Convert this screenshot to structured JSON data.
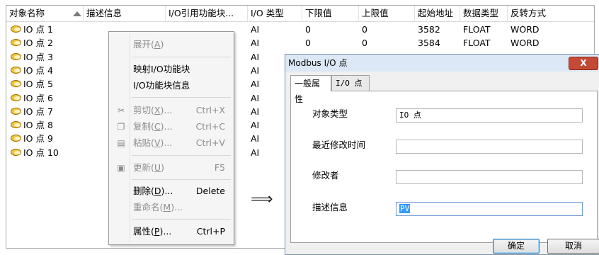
{
  "list": {
    "columns": [
      "对象名称",
      "描述信息",
      "I/O引用功能块...",
      "I/O 类型",
      "下限值",
      "上限值",
      "起始地址",
      "数据类型",
      "反转方式"
    ],
    "rows": [
      {
        "name": "IO 点 1",
        "type": "AI",
        "low": "0",
        "high": "0",
        "addr": "3582",
        "dtype": "FLOAT",
        "rev": "WORD"
      },
      {
        "name": "IO 点 2",
        "type": "AI",
        "low": "0",
        "high": "0",
        "addr": "3584",
        "dtype": "FLOAT",
        "rev": "WORD"
      },
      {
        "name": "IO 点 3",
        "type": "AI",
        "low": "",
        "high": "",
        "addr": "",
        "dtype": "",
        "rev": ""
      },
      {
        "name": "IO 点 4",
        "type": "AI",
        "low": "",
        "high": "",
        "addr": "",
        "dtype": "",
        "rev": ""
      },
      {
        "name": "IO 点 5",
        "type": "AI",
        "low": "",
        "high": "",
        "addr": "",
        "dtype": "",
        "rev": ""
      },
      {
        "name": "IO 点 6",
        "type": "AI",
        "low": "",
        "high": "",
        "addr": "",
        "dtype": "",
        "rev": ""
      },
      {
        "name": "IO 点 7",
        "type": "AI",
        "low": "",
        "high": "",
        "addr": "",
        "dtype": "",
        "rev": ""
      },
      {
        "name": "IO 点 8",
        "type": "AI",
        "low": "",
        "high": "",
        "addr": "",
        "dtype": "",
        "rev": ""
      },
      {
        "name": "IO 点 9",
        "type": "AI",
        "low": "",
        "high": "",
        "addr": "",
        "dtype": "",
        "rev": ""
      },
      {
        "name": "IO 点 10",
        "type": "AI",
        "low": "",
        "high": "",
        "addr": "",
        "dtype": "",
        "rev": ""
      }
    ]
  },
  "context_menu": {
    "expand": {
      "label": "展开",
      "key": "A"
    },
    "map_io": "映射I/O功能块",
    "io_info": "I/O功能块信息",
    "cut": {
      "label": "剪切",
      "key": "X",
      "tail": "...",
      "shortcut": "Ctrl+X"
    },
    "copy": {
      "label": "复制",
      "key": "C",
      "tail": "...",
      "shortcut": "Ctrl+C"
    },
    "paste": {
      "label": "粘贴",
      "key": "V",
      "tail": "...",
      "shortcut": "Ctrl+V"
    },
    "refresh": {
      "label": "更新",
      "key": "U",
      "shortcut": "F5"
    },
    "delete": {
      "label": "删除",
      "key": "D",
      "tail": "...",
      "shortcut": "Delete"
    },
    "rename": {
      "label": "重命名",
      "key": "M",
      "tail": "..."
    },
    "properties": {
      "label": "属性",
      "key": "P",
      "tail": "...",
      "shortcut": "Ctrl+P"
    }
  },
  "arrow": "⟹",
  "dialog": {
    "title": "Modbus I/O 点",
    "close_label": "X",
    "tabs": [
      "一般属性",
      "I/O 点"
    ],
    "fields": [
      {
        "label": "对象类型",
        "value": "IO 点"
      },
      {
        "label": "最近修改时间",
        "value": ""
      },
      {
        "label": "修改者",
        "value": ""
      },
      {
        "label": "描述信息",
        "value": "PV"
      }
    ],
    "ok": "确定",
    "cancel": "取消"
  },
  "colors": {
    "accent": "#3399ff",
    "close_button": "#c44a36",
    "title_bar": "#dce8f5",
    "icon": "#f0c53a"
  }
}
